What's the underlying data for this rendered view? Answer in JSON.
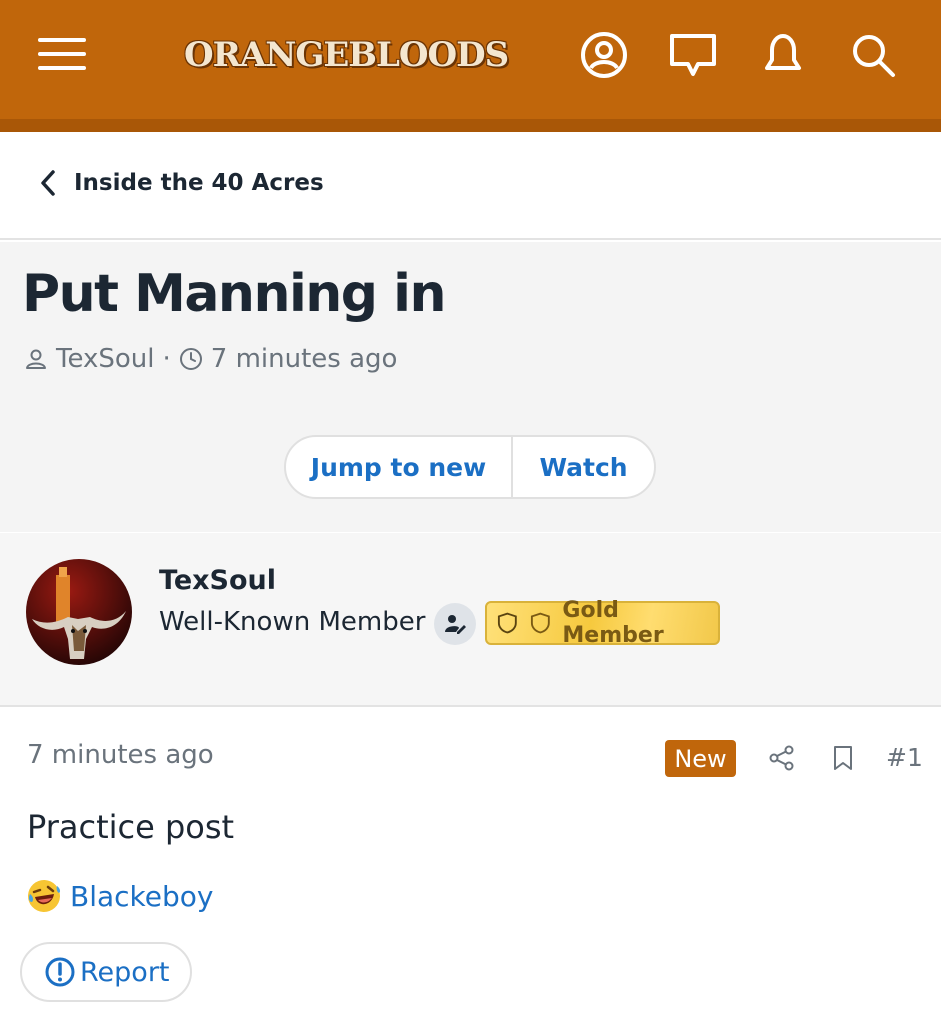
{
  "header": {
    "logo_text": "ORANGEBLOODS",
    "colors": {
      "bar": "#c0660b",
      "icon": "#ffffff"
    },
    "icons": [
      "menu-icon",
      "account-icon",
      "conversations-icon",
      "alerts-icon",
      "search-icon"
    ]
  },
  "breadcrumb": {
    "back_icon": "chevron-left-icon",
    "label": "Inside the 40 Acres"
  },
  "thread": {
    "title": "Put Manning in",
    "author": "TexSoul",
    "separator": "·",
    "time": "7 minutes ago",
    "buttons": {
      "jump": "Jump to new",
      "watch": "Watch"
    }
  },
  "user": {
    "name": "TexSoul",
    "title": "Well-Known Member",
    "badge": "Gold Member",
    "avatar_icon": "longhorn-tower-avatar"
  },
  "post": {
    "time": "7 minutes ago",
    "new_label": "New",
    "number": "#1",
    "body": "Practice post",
    "reaction_icon": "laughing-emoji-icon",
    "reaction_user": "Blackeboy",
    "report_label": "Report"
  },
  "colors": {
    "accent": "#c0660b",
    "link": "#1b6fc4",
    "text": "#1c2733",
    "muted": "#6a737c",
    "gold": "#f6c93e"
  }
}
